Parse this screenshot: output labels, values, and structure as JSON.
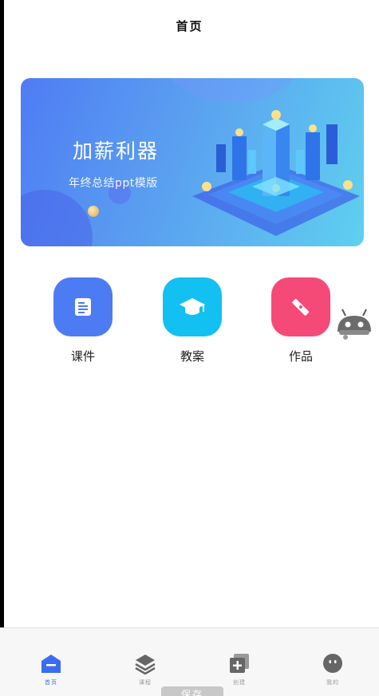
{
  "header": {
    "title": "首页"
  },
  "banner": {
    "headline": "加薪利器",
    "subtitle": "年终总结ppt模版"
  },
  "quick_actions": [
    {
      "label": "课件",
      "icon": "document-icon",
      "color": "#4d7bf3"
    },
    {
      "label": "教案",
      "icon": "graduation-cap-icon",
      "color": "#12c0f2"
    },
    {
      "label": "作品",
      "icon": "pencil-ruler-icon",
      "color": "#f54a77"
    }
  ],
  "tabbar": {
    "items": [
      {
        "label": "首页",
        "icon": "home-icon",
        "active": true
      },
      {
        "label": "课程",
        "icon": "layers-icon",
        "active": false
      },
      {
        "label": "创建",
        "icon": "add-square-icon",
        "active": false
      },
      {
        "label": "我的",
        "icon": "profile-face-icon",
        "active": false
      }
    ]
  },
  "toast": {
    "text": "保存"
  },
  "colors": {
    "accent": "#3a6cf0",
    "inactive": "#999999"
  }
}
